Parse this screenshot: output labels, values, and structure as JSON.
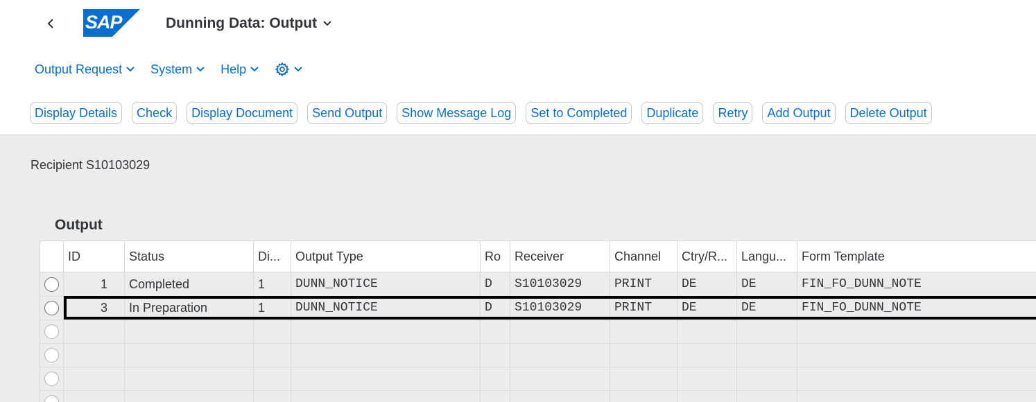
{
  "header": {
    "title": "Dunning Data: Output",
    "logo_text": "SAP",
    "logo_color": "#0a6ed1"
  },
  "menu": [
    {
      "label": "Output Request"
    },
    {
      "label": "System"
    },
    {
      "label": "Help"
    }
  ],
  "toolbar": [
    {
      "label": "Display Details"
    },
    {
      "label": "Check"
    },
    {
      "label": "Display Document"
    },
    {
      "label": "Send Output"
    },
    {
      "label": "Show Message Log"
    },
    {
      "label": "Set to Completed"
    },
    {
      "label": "Duplicate"
    },
    {
      "label": "Retry"
    },
    {
      "label": "Add Output"
    },
    {
      "label": "Delete Output"
    }
  ],
  "recipient": "Recipient S10103029",
  "table": {
    "title": "Output",
    "columns": [
      "ID",
      "Status",
      "Di...",
      "Output Type",
      "Ro",
      "Receiver",
      "Channel",
      "Ctry/R...",
      "Langu...",
      "Form Template"
    ],
    "rows": [
      [
        "1",
        "Completed",
        "1",
        "DUNN_NOTICE",
        "D",
        "S10103029",
        "PRINT",
        "DE",
        "DE",
        "FIN_FO_DUNN_NOTE"
      ],
      [
        "3",
        "In Preparation",
        "1",
        "DUNN_NOTICE",
        "D",
        "S10103029",
        "PRINT",
        "DE",
        "DE",
        "FIN_FO_DUNN_NOTE"
      ]
    ],
    "selected_row": 2
  }
}
